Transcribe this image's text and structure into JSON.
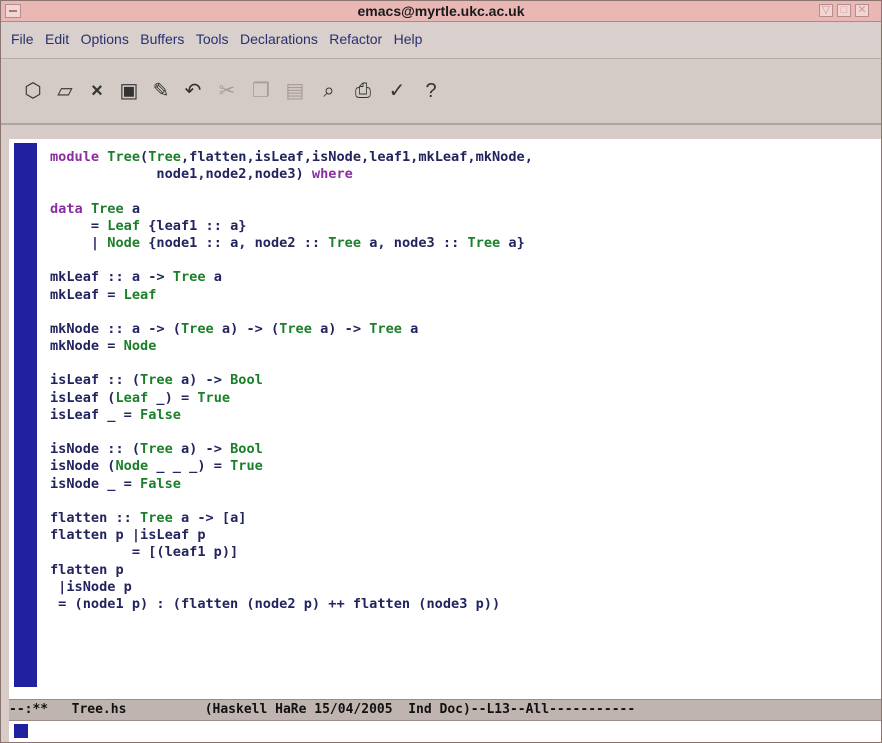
{
  "window": {
    "title": "emacs@myrtle.ukc.ac.uk"
  },
  "menubar": {
    "items": [
      "File",
      "Edit",
      "Options",
      "Buffers",
      "Tools",
      "Declarations",
      "Refactor",
      "Help"
    ]
  },
  "toolbar": {
    "icons": [
      "open-file-icon",
      "open-directory-icon",
      "close-icon",
      "save-icon",
      "save-as-icon",
      "undo-icon",
      "cut-icon",
      "copy-icon",
      "paste-icon",
      "search-icon",
      "print-icon",
      "spell-check-icon",
      "help-icon"
    ]
  },
  "editor": {
    "lines": [
      [
        [
          "k",
          "module"
        ],
        [
          "d",
          " "
        ],
        [
          "t",
          "Tree"
        ],
        [
          "d",
          "("
        ],
        [
          "t",
          "Tree"
        ],
        [
          "d",
          ",flatten,isLeaf,isNode,leaf1,mkLeaf,mkNode,"
        ]
      ],
      [
        [
          "d",
          "             node1,node2,node3) "
        ],
        [
          "k",
          "where"
        ]
      ],
      [
        [
          "d",
          ""
        ]
      ],
      [
        [
          "k",
          "data"
        ],
        [
          "d",
          " "
        ],
        [
          "t",
          "Tree"
        ],
        [
          "d",
          " a"
        ]
      ],
      [
        [
          "d",
          "     = "
        ],
        [
          "t",
          "Leaf"
        ],
        [
          "d",
          " {leaf1 :: a}"
        ]
      ],
      [
        [
          "d",
          "     | "
        ],
        [
          "t",
          "Node"
        ],
        [
          "d",
          " {node1 :: a, node2 :: "
        ],
        [
          "t",
          "Tree"
        ],
        [
          "d",
          " a, node3 :: "
        ],
        [
          "t",
          "Tree"
        ],
        [
          "d",
          " a}"
        ]
      ],
      [
        [
          "d",
          ""
        ]
      ],
      [
        [
          "d",
          "mkLeaf :: a -> "
        ],
        [
          "t",
          "Tree"
        ],
        [
          "d",
          " a"
        ]
      ],
      [
        [
          "d",
          "mkLeaf = "
        ],
        [
          "t",
          "Leaf"
        ]
      ],
      [
        [
          "d",
          ""
        ]
      ],
      [
        [
          "d",
          "mkNode :: a -> ("
        ],
        [
          "t",
          "Tree"
        ],
        [
          "d",
          " a) -> ("
        ],
        [
          "t",
          "Tree"
        ],
        [
          "d",
          " a) -> "
        ],
        [
          "t",
          "Tree"
        ],
        [
          "d",
          " a"
        ]
      ],
      [
        [
          "d",
          "mkNode = "
        ],
        [
          "t",
          "Node"
        ]
      ],
      [
        [
          "d",
          ""
        ]
      ],
      [
        [
          "d",
          "isLeaf :: ("
        ],
        [
          "t",
          "Tree"
        ],
        [
          "d",
          " a) -> "
        ],
        [
          "t",
          "Bool"
        ]
      ],
      [
        [
          "d",
          "isLeaf ("
        ],
        [
          "t",
          "Leaf"
        ],
        [
          "d",
          " _) = "
        ],
        [
          "t",
          "True"
        ]
      ],
      [
        [
          "d",
          "isLeaf _ = "
        ],
        [
          "t",
          "False"
        ]
      ],
      [
        [
          "d",
          ""
        ]
      ],
      [
        [
          "d",
          "isNode :: ("
        ],
        [
          "t",
          "Tree"
        ],
        [
          "d",
          " a) -> "
        ],
        [
          "t",
          "Bool"
        ]
      ],
      [
        [
          "d",
          "isNode ("
        ],
        [
          "t",
          "Node"
        ],
        [
          "d",
          " _ _ _) = "
        ],
        [
          "t",
          "True"
        ]
      ],
      [
        [
          "d",
          "isNode _ = "
        ],
        [
          "t",
          "False"
        ]
      ],
      [
        [
          "d",
          ""
        ]
      ],
      [
        [
          "d",
          "flatten :: "
        ],
        [
          "t",
          "Tree"
        ],
        [
          "d",
          " a -> [a]"
        ]
      ],
      [
        [
          "d",
          "flatten p |isLeaf p"
        ]
      ],
      [
        [
          "d",
          "          = [(leaf1 p)]"
        ]
      ],
      [
        [
          "d",
          "flatten p"
        ]
      ],
      [
        [
          "d",
          " |isNode p"
        ]
      ],
      [
        [
          "d",
          " = (node1 p) : (flatten (node2 p) ++ flatten (node3 p))"
        ]
      ]
    ]
  },
  "modeline": {
    "status": "--:**",
    "buffer_name": "Tree.hs",
    "mode_info": "(Haskell HaRe 15/04/2005  Ind Doc)--L13--All-----------"
  },
  "colors": {
    "keyword": "#8a2fa0",
    "type": "#1b7f2a",
    "default": "#22245e",
    "fringe": "#2020a0",
    "titlebar": "#e9b7b4"
  }
}
